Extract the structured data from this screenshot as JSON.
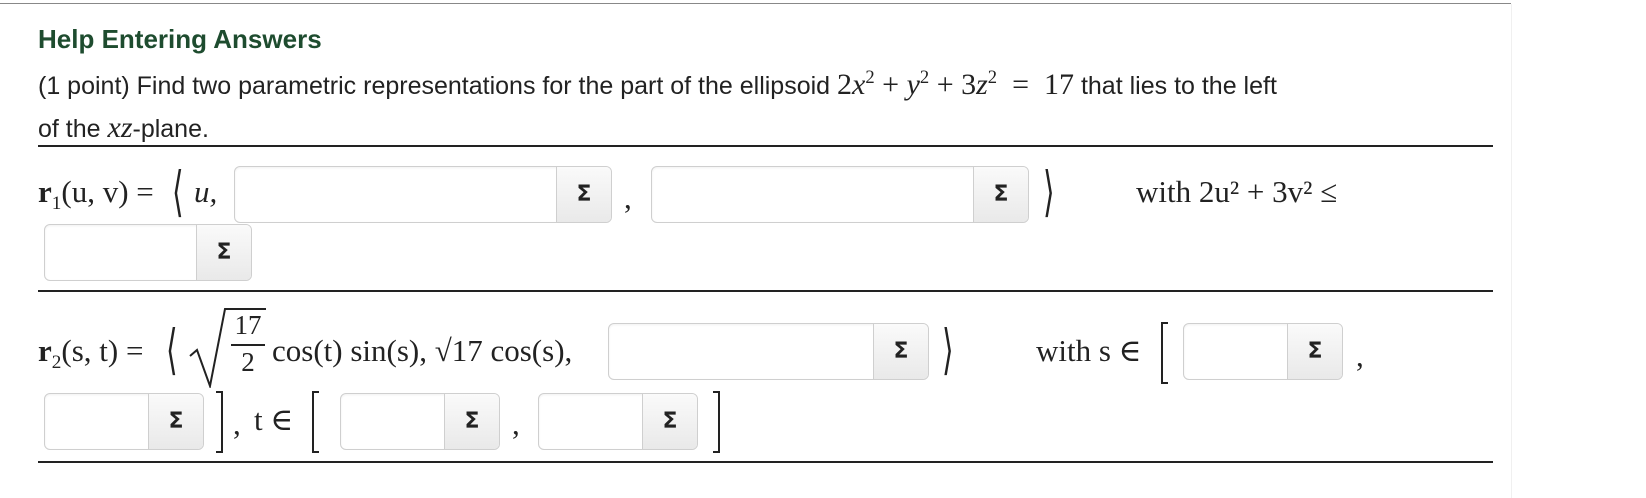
{
  "header": {
    "title": "Help Entering Answers"
  },
  "problem": {
    "intro": "(1 point) Find two parametric representations for the part of the ellipsoid ",
    "outro": " that lies to the left",
    "line2_pre": "of the ",
    "plane": "xz",
    "line2_post": "-plane."
  },
  "r1": {
    "lhs": "(u, v) = ",
    "first": "u,",
    "comma": ",",
    "constraint": "with 2u² + 3v² ≤",
    "answers": [
      "",
      "",
      ""
    ]
  },
  "r2": {
    "lhs": "(s, t) = ",
    "frac_num": "17",
    "frac_den": "2",
    "rest": "cos(t) sin(s), √17 cos(s),",
    "s_label": "with s ∈",
    "t_label": "t ∈",
    "comma": ",",
    "answers": [
      "",
      "",
      "",
      "",
      ""
    ]
  },
  "sigma": "Σ"
}
